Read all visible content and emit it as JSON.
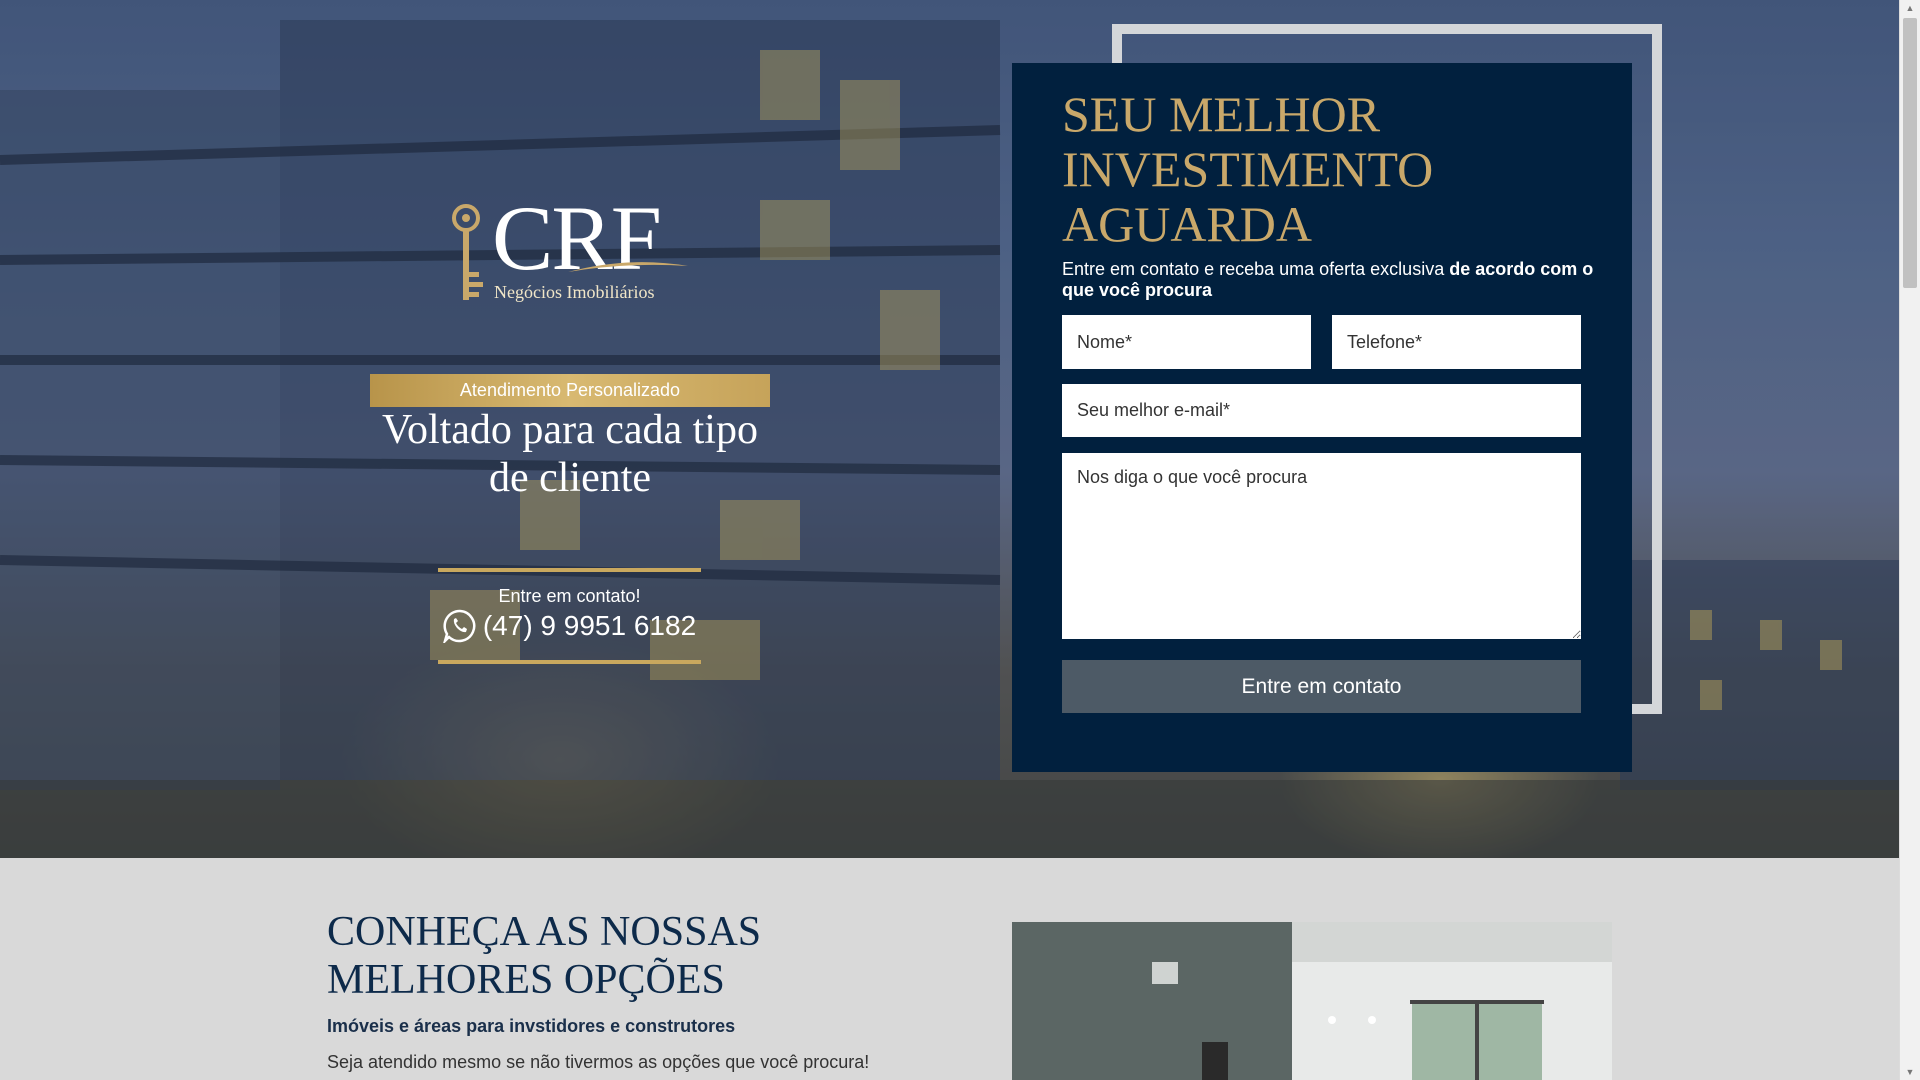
{
  "brand": {
    "logo_text": "CRF",
    "logo_subtitle": "Negócios Imobiliários"
  },
  "hero": {
    "badge": "Atendimento Personalizado",
    "headline": "Voltado para cada tipo de cliente",
    "contact_label": "Entre em contato!",
    "phone": "(47) 9 9951 6182"
  },
  "form": {
    "title": "SEU MELHOR INVESTIMENTO AGUARDA",
    "subtitle_plain": "Entre em contato e receba uma oferta exclusiva ",
    "subtitle_bold": "de acordo com o que você procura",
    "name_placeholder": "Nome*",
    "phone_placeholder": "Telefone*",
    "email_placeholder": "Seu melhor e-mail*",
    "message_placeholder": "Nos diga o que você procura",
    "submit_label": "Entre em contato"
  },
  "section": {
    "title": "CONHEÇA AS NOSSAS MELHORES OPÇÕES",
    "subtitle": "Imóveis e áreas para invstidores e construtores",
    "body": "Seja atendido mesmo se não tivermos as opções que você procura!"
  },
  "colors": {
    "navy": "#01203e",
    "gold": "#c9a86a",
    "button": "#4d5a66",
    "section_bg": "#d9d9d9"
  },
  "icons": {
    "phone": "whatsapp-icon",
    "logo": "key-icon"
  }
}
